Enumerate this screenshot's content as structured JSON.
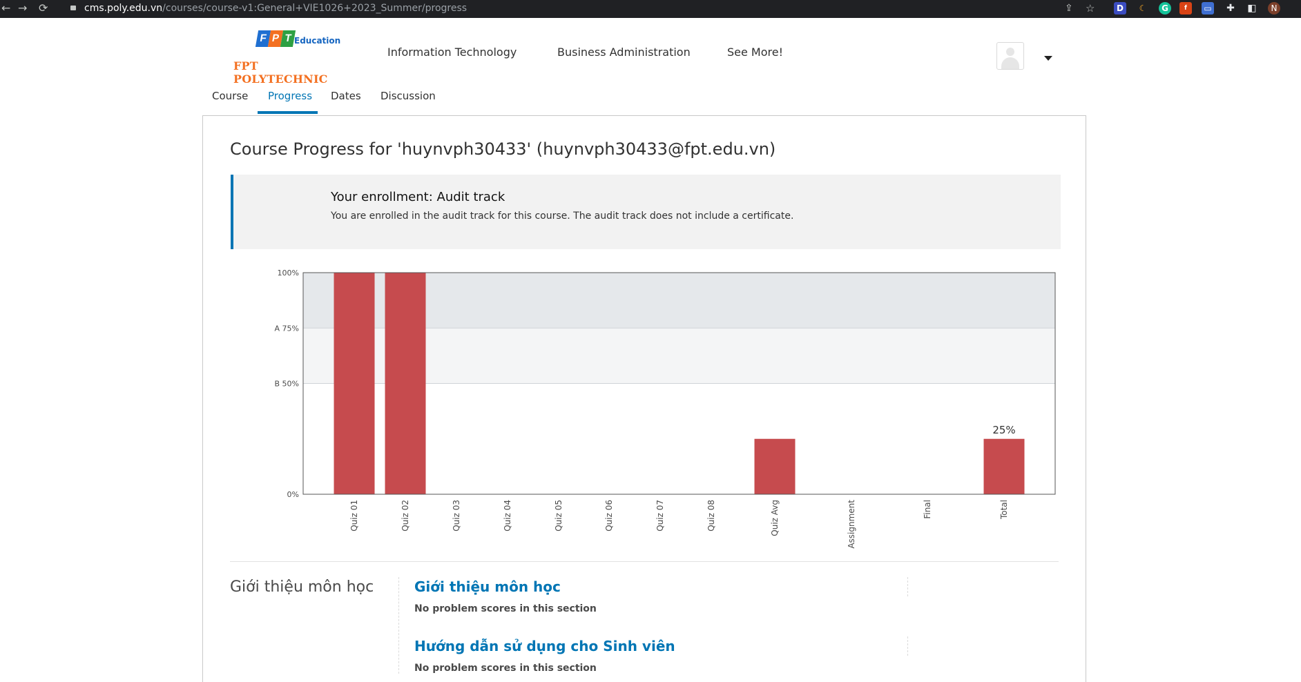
{
  "browser": {
    "url_host": "cms.poly.edu.vn",
    "url_path": "/courses/course-v1:General+VIE1026+2023_Summer/progress",
    "ext_d": "D",
    "ext_g": "G",
    "profile": "N"
  },
  "logo": {
    "tiles": [
      "F",
      "P",
      "T"
    ],
    "education": "Education",
    "polytechnic": "FPT POLYTECHNIC"
  },
  "top_nav": [
    "Information Technology",
    "Business Administration",
    "See More!"
  ],
  "tabs": [
    {
      "label": "Course"
    },
    {
      "label": "Progress",
      "active": true
    },
    {
      "label": "Dates"
    },
    {
      "label": "Discussion"
    }
  ],
  "page_title": "Course Progress for 'huynvph30433' (huynvph30433@fpt.edu.vn)",
  "alert": {
    "title": "Your enrollment: Audit track",
    "body": "You are enrolled in the audit track for this course. The audit track does not include a certificate."
  },
  "chart_data": {
    "type": "bar",
    "categories": [
      "Quiz 01",
      "Quiz 02",
      "Quiz 03",
      "Quiz 04",
      "Quiz 05",
      "Quiz 06",
      "Quiz 07",
      "Quiz 08",
      "Quiz Avg",
      "Assignment",
      "Final",
      "Total"
    ],
    "values": [
      100,
      100,
      0,
      0,
      0,
      0,
      0,
      0,
      25,
      0,
      0,
      25
    ],
    "ylim": [
      0,
      100
    ],
    "y_ticks": [
      {
        "value": 100,
        "label": "100%"
      },
      {
        "value": 75,
        "label": "A 75%"
      },
      {
        "value": 50,
        "label": "B 50%"
      },
      {
        "value": 0,
        "label": "0%"
      }
    ],
    "grade_bands": [
      {
        "from": 75,
        "to": 100,
        "color": "#e5e8eb"
      },
      {
        "from": 50,
        "to": 75,
        "color": "#f4f5f6"
      }
    ],
    "total_label": "25%",
    "bar_color": "#c64b4e"
  },
  "sections": {
    "chapter": "Giới thiệu môn học",
    "items": [
      {
        "title": "Giới thiệu môn học",
        "note": "No problem scores in this section"
      },
      {
        "title": "Hướng dẫn sử dụng cho Sinh viên",
        "note": "No problem scores in this section"
      }
    ]
  },
  "colors": {
    "accent": "#0075b4",
    "logo_orange": "#f37021"
  }
}
